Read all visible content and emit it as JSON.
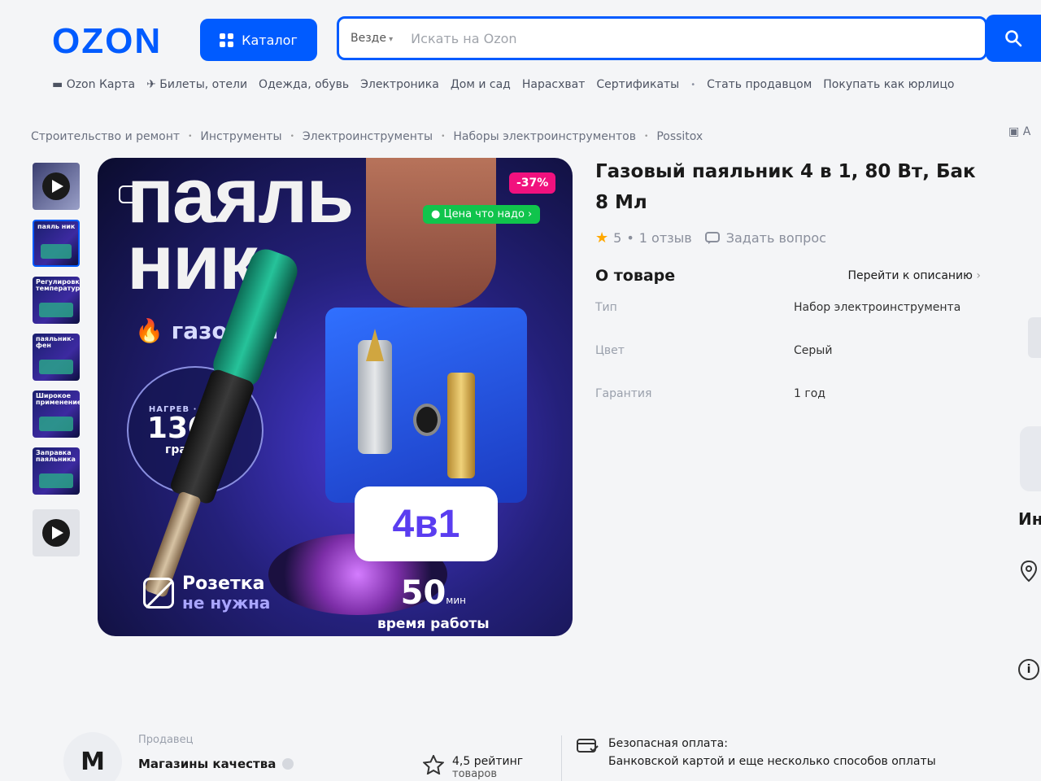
{
  "header": {
    "logo": "OZON",
    "catalog_label": "Каталог",
    "search": {
      "scope": "Везде",
      "placeholder": "Искать на Ozon"
    }
  },
  "nav": {
    "items": [
      "Ozon Карта",
      "Билеты, отели",
      "Одежда, обувь",
      "Электроника",
      "Дом и сад",
      "Нарасхват",
      "Сертификаты"
    ],
    "extra": [
      "Стать продавцом",
      "Покупать как юрлицо"
    ]
  },
  "breadcrumb": [
    "Строительство и ремонт",
    "Инструменты",
    "Электроинструменты",
    "Наборы электроинструментов",
    "Possitox"
  ],
  "chat_tab_fragment": "А",
  "product": {
    "title": "Газовый паяльник 4 в 1, 80 Вт, Бак 8 Мл",
    "rating": "5",
    "reviews": "1 отзыв",
    "ask_question": "Задать вопрос",
    "about_title": "О товаре",
    "about_link": "Перейти к описанию",
    "specs": [
      {
        "key": "Тип",
        "value": "Набор электроинструмента"
      },
      {
        "key": "Цвет",
        "value": "Серый"
      },
      {
        "key": "Гарантия",
        "value": "1 год"
      }
    ]
  },
  "image": {
    "title_line1": "паяль",
    "title_line2": "ник",
    "gas_label": "газовый",
    "discount": "-37%",
    "price_label": "Цена что надо",
    "heat_arc": "НАГРЕВ · НАГРЕВ",
    "temperature": "1300°",
    "degrees": "градусов",
    "combo": "4в1",
    "socket_line1": "Розетка",
    "socket_line2": "не нужна",
    "time_value": "50",
    "time_unit": "мин",
    "time_caption": "время работы"
  },
  "thumbnails": [
    {
      "type": "video",
      "text": ""
    },
    {
      "type": "image",
      "text": "паяль ник",
      "selected": true
    },
    {
      "type": "image",
      "text": "Регулировка температуры"
    },
    {
      "type": "image",
      "text": "паяльник-фен"
    },
    {
      "type": "image",
      "text": "Широкое применение"
    },
    {
      "type": "image",
      "text": "Заправка паяльника"
    },
    {
      "type": "video",
      "text": ""
    }
  ],
  "side_fragment": "Ин",
  "seller": {
    "avatar_letter": "M",
    "label": "Продавец",
    "name": "Магазины качества",
    "rating": "4,5 рейтинг",
    "rating_sub": "товаров",
    "payment_title": "Безопасная оплата:",
    "payment_sub": "Банковской картой и еще несколько способов оплаты"
  },
  "colors": {
    "accent": "#005bff",
    "discount": "#f1117e",
    "price_label": "#10c44c",
    "star": "#ffa800"
  }
}
